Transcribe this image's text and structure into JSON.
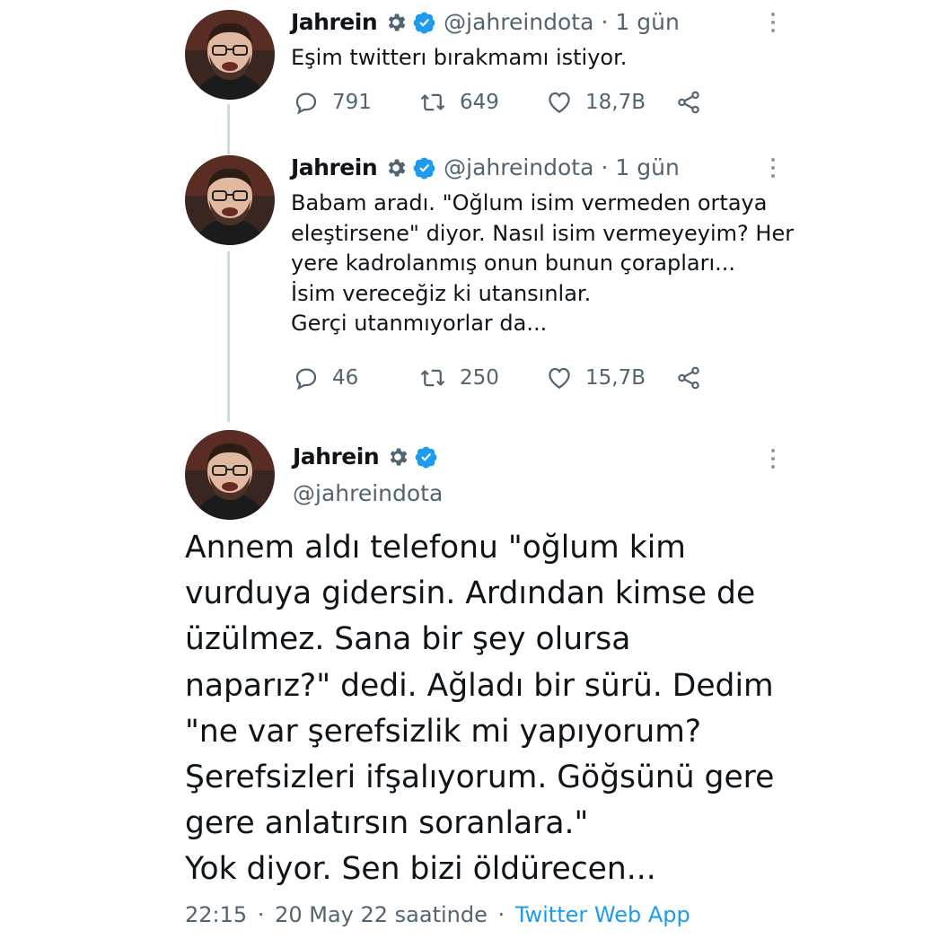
{
  "colors": {
    "accent": "#1d9bf0",
    "muted": "#536471",
    "text": "#0f1419",
    "thread": "#cfd9de"
  },
  "tweets": [
    {
      "name": "Jahrein",
      "handle": "@jahreindota",
      "separator": "·",
      "time": "1 gün",
      "text": "Eşim twitterı bırakmamı istiyor.",
      "replies": "791",
      "retweets": "649",
      "likes": "18,7B"
    },
    {
      "name": "Jahrein",
      "handle": "@jahreindota",
      "separator": "·",
      "time": "1 gün",
      "text": "Babam aradı. \"Oğlum isim vermeden ortaya\neleştirsene\" diyor. Nasıl isim vermeyeyim? Her\nyere kadrolanmış onun bunun çorapları...\nİsim vereceğiz ki utansınlar.\nGerçi utanmıyorlar da...",
      "replies": "46",
      "retweets": "250",
      "likes": "15,7B"
    }
  ],
  "main_tweet": {
    "name": "Jahrein",
    "handle": "@jahreindota",
    "text": "Annem aldı telefonu \"oğlum kim\nvurduya gidersin. Ardından kimse de\nüzülmez. Sana bir şey olursa\nnaparız?\" dedi. Ağladı bir sürü. Dedim\n\"ne var şerefsizlik mi yapıyorum?\nŞerefsizleri ifşalıyorum. Göğsünü gere\ngere anlatırsın soranlara.\"\nYok diyor. Sen bizi öldürecen...",
    "time": "22:15",
    "date": "20 May 22 saatinde",
    "separator": "·",
    "source": "Twitter Web App"
  },
  "icons": [
    "avatar",
    "gear-icon",
    "verified-badge-icon",
    "more-icon",
    "reply-icon",
    "retweet-icon",
    "like-icon",
    "share-icon"
  ]
}
